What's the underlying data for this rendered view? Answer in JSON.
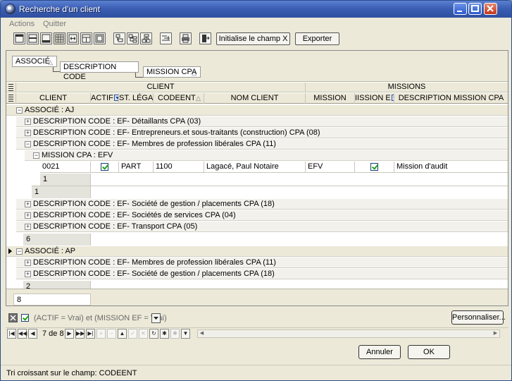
{
  "window": {
    "title": "Recherche d'un client"
  },
  "menu": {
    "actions": "Actions",
    "quit": "Quitter"
  },
  "toolbar": {
    "init_field": "Initialise le champ X",
    "export": "Exporter"
  },
  "group_panel": {
    "chips": [
      "ASSOCIÉ",
      "DESCRIPTION CODE",
      "MISSION CPA"
    ]
  },
  "bands": {
    "client": "CLIENT",
    "missions": "MISSIONS"
  },
  "columns": [
    "CLIENT",
    "ACTIF",
    "ST. LÉGAL",
    "CODEENT",
    "NOM CLIENT",
    "MISSION",
    "IISSION E",
    "DESCRIPTION MISSION CPA"
  ],
  "groups": {
    "aj": "ASSOCIÉ : AJ",
    "aj_codes": [
      "DESCRIPTION CODE : EF- Détaillants CPA (03)",
      "DESCRIPTION CODE : EF- Entrepreneurs.et sous-traitants (construction) CPA (08)",
      "DESCRIPTION CODE : EF- Membres de profession libérales CPA (11)"
    ],
    "mission_efv": "MISSION CPA : EFV",
    "aj_codes_after": [
      "DESCRIPTION CODE : EF- Société de gestion / placements CPA (18)",
      "DESCRIPTION CODE : EF- Sociétés de services CPA (04)",
      "DESCRIPTION CODE : EF- Transport CPA  (05)"
    ],
    "ap": "ASSOCIÉ : AP",
    "ap_codes": [
      "DESCRIPTION CODE : EF- Membres de profession libérales CPA (11)",
      "DESCRIPTION CODE : EF- Société de gestion / placements CPA (18)"
    ]
  },
  "data_row": {
    "client": "0021",
    "st_legal": "PART",
    "codeent": "1100",
    "nom_client": "Lagacé, Paul Notaire",
    "mission": "EFV",
    "description": "Mission d'audit"
  },
  "summaries": {
    "mission": "1",
    "code": "1",
    "aj": "6",
    "ap": "2",
    "total": "8"
  },
  "filter": {
    "expression": "(ACTIF = Vrai) et (MISSION EF = Vrai)",
    "customize": "Personnaliser..."
  },
  "navigator": {
    "position": "7 de 8"
  },
  "buttons": {
    "cancel": "Annuler",
    "ok": "OK"
  },
  "status": {
    "text": "Tri croissant sur le champ: CODEENT"
  }
}
